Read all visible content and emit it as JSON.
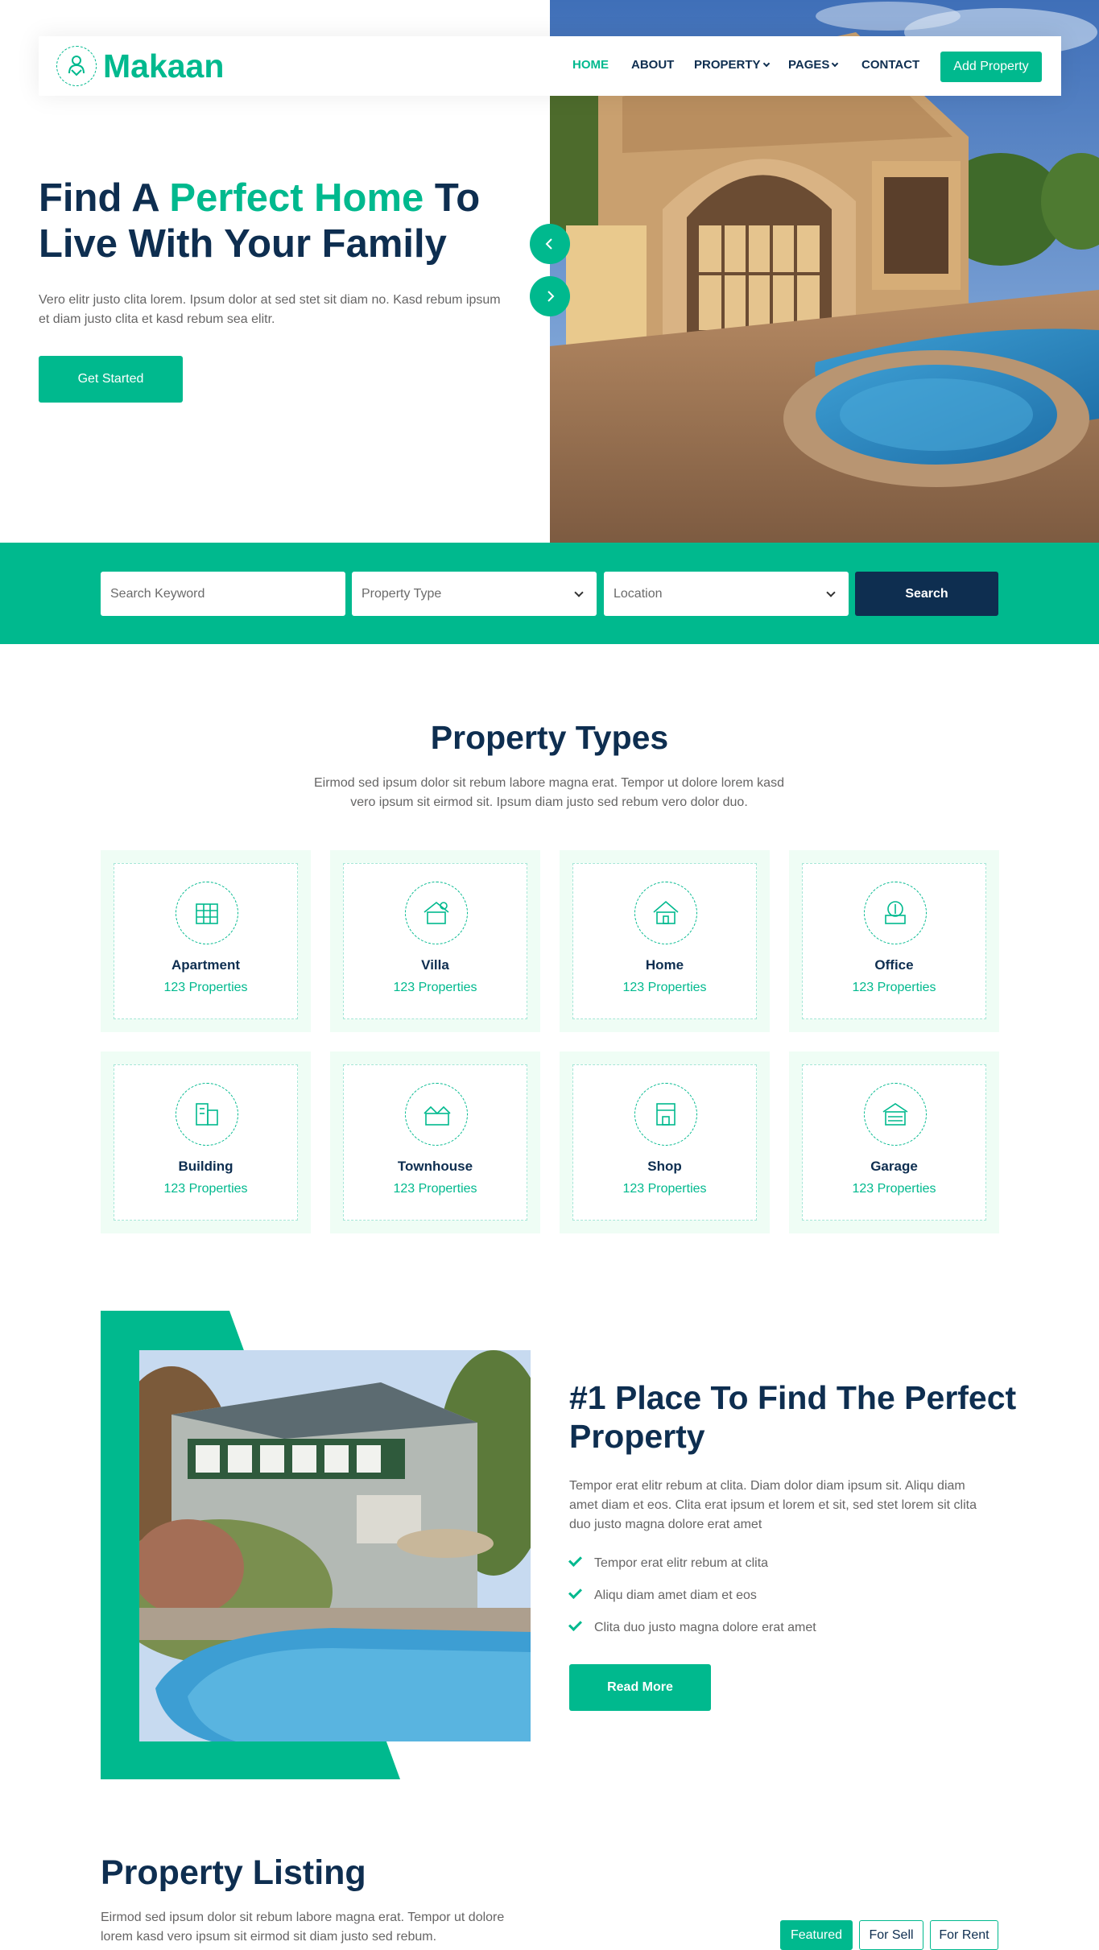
{
  "brand": {
    "name": "Makaan",
    "accent": "#00B98E",
    "dark": "#0E2E50",
    "light": "#EFFDF5"
  },
  "nav": {
    "items": [
      {
        "label": "HOME",
        "active": true,
        "dropdown": false
      },
      {
        "label": "ABOUT",
        "active": false,
        "dropdown": false
      },
      {
        "label": "PROPERTY",
        "active": false,
        "dropdown": true
      },
      {
        "label": "PAGES",
        "active": false,
        "dropdown": true
      },
      {
        "label": "CONTACT",
        "active": false,
        "dropdown": false
      }
    ],
    "cta_label": "Add Property"
  },
  "hero": {
    "title_start": "Find A ",
    "title_highlight": "Perfect Home",
    "title_end": " To Live With Your Family",
    "description": "Vero elitr justo clita lorem. Ipsum dolor at sed stet sit diam no. Kasd rebum ipsum et diam justo clita et kasd rebum sea elitr.",
    "cta_label": "Get Started"
  },
  "search": {
    "keyword_placeholder": "Search Keyword",
    "type_label": "Property Type",
    "location_label": "Location",
    "button_label": "Search"
  },
  "types_section": {
    "title": "Property Types",
    "subtitle": "Eirmod sed ipsum dolor sit rebum labore magna erat. Tempor ut dolore lorem kasd vero ipsum sit eirmod sit. Ipsum diam justo sed rebum vero dolor duo.",
    "items": [
      {
        "name": "Apartment",
        "count": "123 Properties",
        "icon": "apartment-icon"
      },
      {
        "name": "Villa",
        "count": "123 Properties",
        "icon": "villa-icon"
      },
      {
        "name": "Home",
        "count": "123 Properties",
        "icon": "home-icon"
      },
      {
        "name": "Office",
        "count": "123 Properties",
        "icon": "office-icon"
      },
      {
        "name": "Building",
        "count": "123 Properties",
        "icon": "building-icon"
      },
      {
        "name": "Townhouse",
        "count": "123 Properties",
        "icon": "townhouse-icon"
      },
      {
        "name": "Shop",
        "count": "123 Properties",
        "icon": "shop-icon"
      },
      {
        "name": "Garage",
        "count": "123 Properties",
        "icon": "garage-icon"
      }
    ]
  },
  "about": {
    "title": "#1 Place To Find The Perfect Property",
    "description": "Tempor erat elitr rebum at clita. Diam dolor diam ipsum sit. Aliqu diam amet diam et eos. Clita erat ipsum et lorem et sit, sed stet lorem sit clita duo justo magna dolore erat amet",
    "checks": [
      "Tempor erat elitr rebum at clita",
      "Aliqu diam amet diam et eos",
      "Clita duo justo magna dolore erat amet"
    ],
    "cta_label": "Read More"
  },
  "listing": {
    "title": "Property Listing",
    "description": "Eirmod sed ipsum dolor sit rebum labore magna erat. Tempor ut dolore lorem kasd vero ipsum sit eirmod sit diam justo sed rebum.",
    "tabs": [
      "Featured",
      "For Sell",
      "For Rent"
    ]
  }
}
